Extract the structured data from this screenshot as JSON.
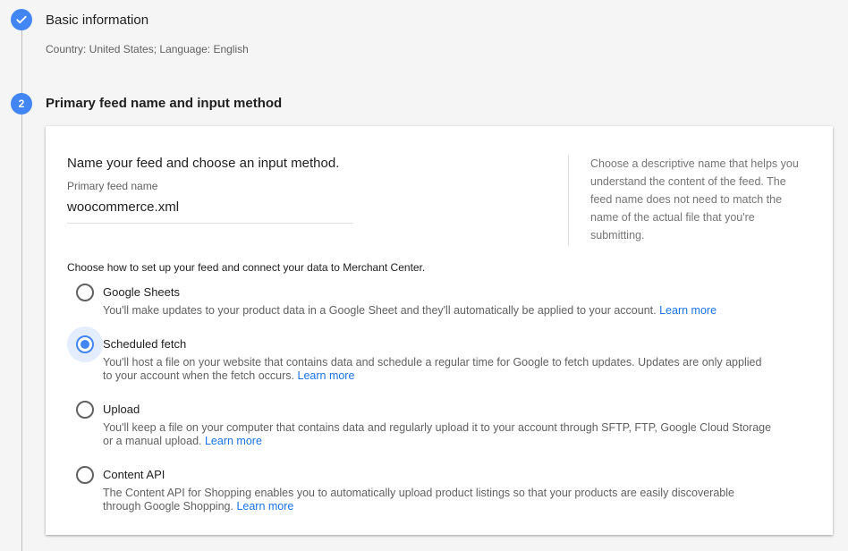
{
  "steps": {
    "step1": {
      "title": "Basic information",
      "subtitle": "Country: United States; Language: English"
    },
    "step2": {
      "number": "2",
      "title": "Primary feed name and input method"
    }
  },
  "card": {
    "heading": "Name your feed and choose an input method.",
    "field_label": "Primary feed name",
    "field_value": "woocommerce.xml",
    "help_text": "Choose a descriptive name that helps you understand the content of the feed. The feed name does not need to match the name of the actual file that you're submitting.",
    "choose_text": "Choose how to set up your feed and connect your data to Merchant Center.",
    "options": [
      {
        "label": "Google Sheets",
        "description": "You'll make updates to your product data in a Google Sheet and they'll automatically be applied to your account.",
        "link": "Learn more",
        "selected": false
      },
      {
        "label": "Scheduled fetch",
        "description": "You'll host a file on your website that contains data and schedule a regular time for Google to fetch updates. Updates are only applied to your account when the fetch occurs.",
        "link": "Learn more",
        "selected": true
      },
      {
        "label": "Upload",
        "description": "You'll keep a file on your computer that contains data and regularly upload it to your account through SFTP, FTP, Google Cloud Storage or a manual upload.",
        "link": "Learn more",
        "selected": false
      },
      {
        "label": "Content API",
        "description": "The Content API for Shopping enables you to automatically upload product listings so that your products are easily discoverable through Google Shopping.",
        "link": "Learn more",
        "selected": false
      }
    ]
  },
  "colors": {
    "accent": "#4285f4",
    "link": "#1a73e8"
  },
  "icons": {
    "step1": "check-icon"
  }
}
